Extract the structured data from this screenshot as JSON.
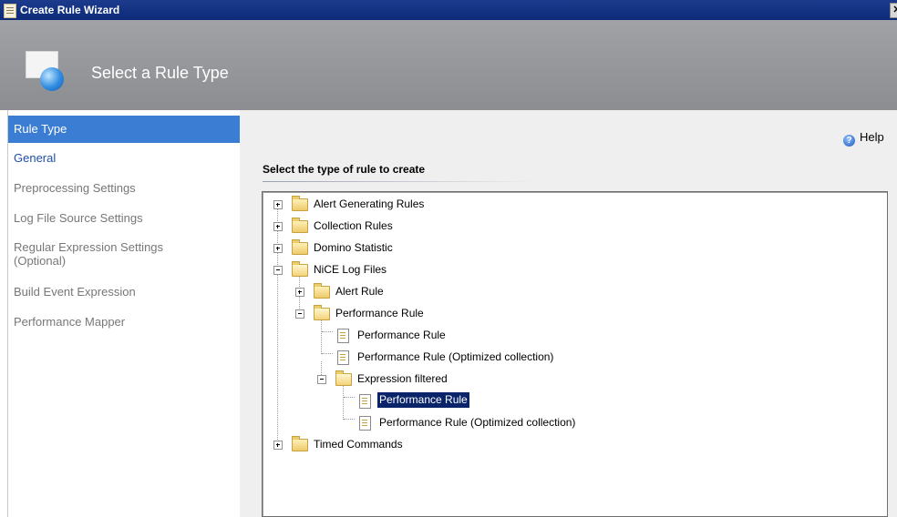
{
  "window": {
    "title": "Create Rule Wizard",
    "close_glyph": "✕"
  },
  "banner": {
    "title": "Select a Rule Type"
  },
  "sidebar": {
    "items": [
      {
        "label": "Rule Type",
        "state": "active"
      },
      {
        "label": "General",
        "state": "link"
      },
      {
        "label": "Preprocessing Settings",
        "state": "disabled"
      },
      {
        "label": "Log File Source Settings",
        "state": "disabled"
      },
      {
        "label": "Regular Expression Settings (Optional)",
        "state": "disabled"
      },
      {
        "label": "Build Event Expression",
        "state": "disabled"
      },
      {
        "label": "Performance Mapper",
        "state": "disabled"
      }
    ]
  },
  "main": {
    "help_label": "Help",
    "section_title": "Select the type of rule to create",
    "tree": [
      {
        "label": "Alert Generating Rules",
        "type": "folder",
        "expanded": false
      },
      {
        "label": "Collection Rules",
        "type": "folder",
        "expanded": false
      },
      {
        "label": "Domino Statistic",
        "type": "folder",
        "expanded": false
      },
      {
        "label": "NiCE Log Files",
        "type": "folder",
        "expanded": true
      },
      {
        "label": "Alert Rule",
        "type": "folder",
        "expanded": false
      },
      {
        "label": "Performance Rule",
        "type": "folder",
        "expanded": true
      },
      {
        "label": "Performance Rule",
        "type": "rule"
      },
      {
        "label": "Performance Rule (Optimized collection)",
        "type": "rule"
      },
      {
        "label": "Expression filtered",
        "type": "folder",
        "expanded": true
      },
      {
        "label": "Performance Rule",
        "type": "rule",
        "selected": true
      },
      {
        "label": "Performance Rule (Optimized collection)",
        "type": "rule"
      },
      {
        "label": "Timed Commands",
        "type": "folder",
        "expanded": false
      }
    ]
  },
  "colors": {
    "titlebar": "#0c2a78",
    "banner": "#8b8d91",
    "active_item": "#3a7dd2",
    "link": "#1f4fa8",
    "selection": "#0a246a"
  }
}
